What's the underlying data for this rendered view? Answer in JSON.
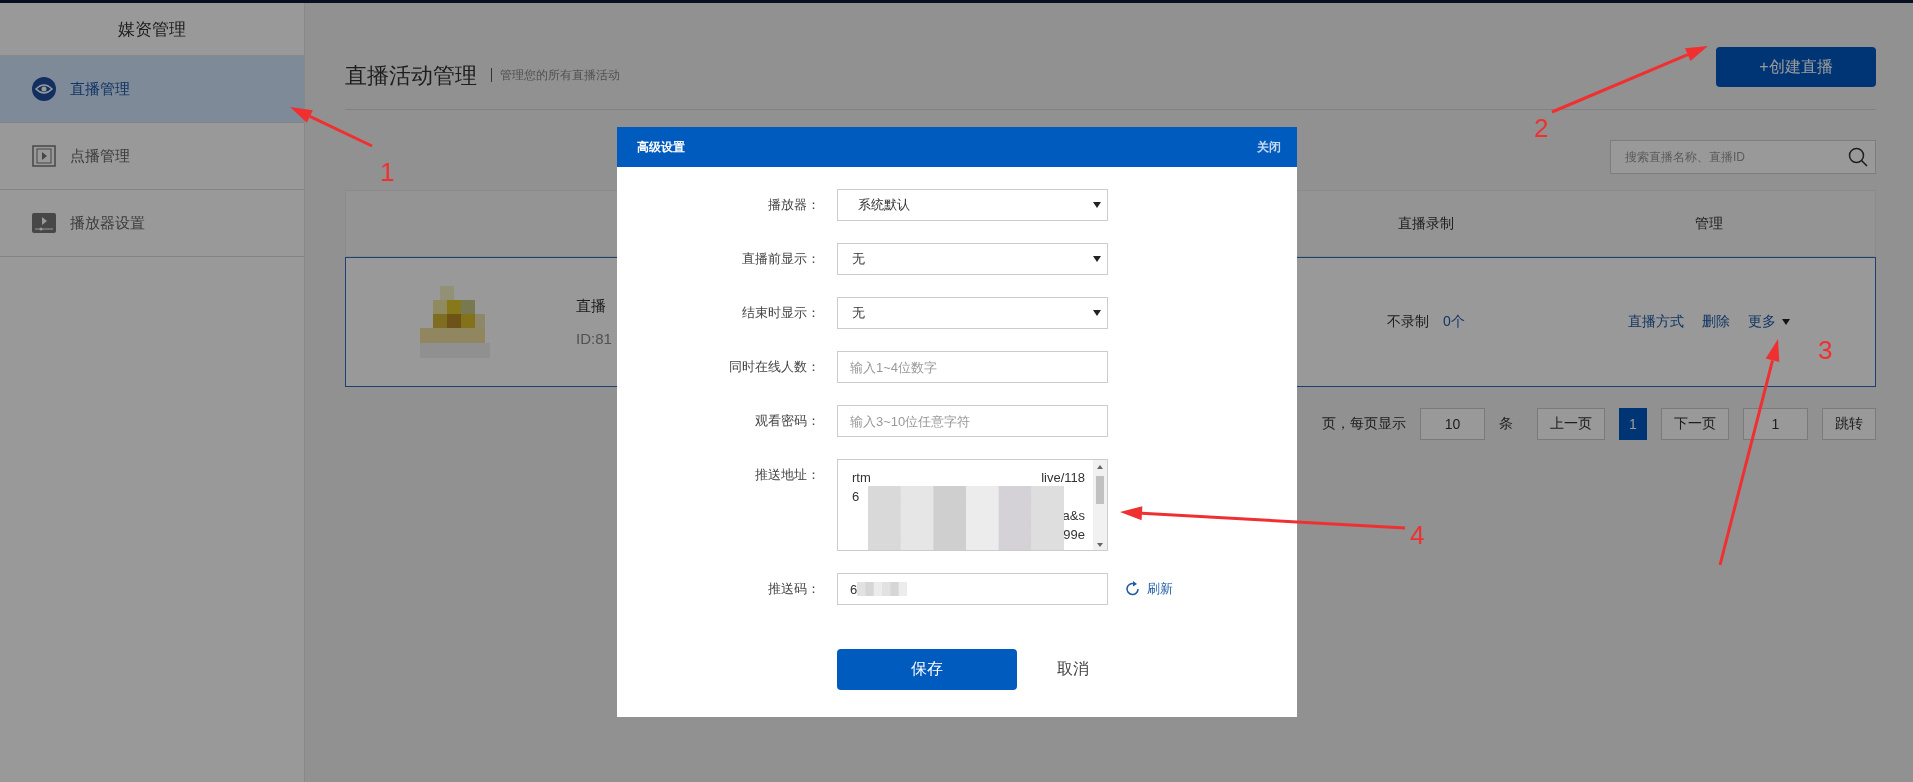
{
  "sidebar": {
    "title": "媒资管理",
    "items": [
      {
        "label": "直播管理",
        "selected": true
      },
      {
        "label": "点播管理",
        "selected": false
      },
      {
        "label": "播放器设置",
        "selected": false
      }
    ]
  },
  "page": {
    "title": "直播活动管理",
    "subtitle": "管理您的所有直播活动",
    "create_button": "+创建直播",
    "search": {
      "placeholder": "搜索直播名称、直播ID"
    }
  },
  "table": {
    "columns": [
      "直播录制",
      "管理"
    ],
    "rows": [
      {
        "thumbnail": {
          "kind": "picture"
        },
        "name": "直播",
        "id": "ID:81",
        "record": "不录制",
        "record_count": "0个",
        "actions": [
          "直播方式",
          "删除",
          "更多"
        ]
      }
    ]
  },
  "pagination": {
    "info": "页，每页显示",
    "page_size": "10",
    "unit": "条",
    "prev": "上一页",
    "pages": [
      {
        "label": "1",
        "selected": true
      }
    ],
    "next": "下一页",
    "jump_value": "1",
    "jump": "跳转"
  },
  "dialog": {
    "title": "高级设置",
    "close": "关闭",
    "fields": [
      {
        "kind": "select",
        "label": "播放器：",
        "value": "系统默认"
      },
      {
        "kind": "select",
        "label": "直播前显示：",
        "value": "无"
      },
      {
        "kind": "select",
        "label": "结束时显示：",
        "value": "无"
      },
      {
        "kind": "input",
        "label": "同时在线人数：",
        "placeholder": "输入1~4位数字"
      },
      {
        "kind": "input",
        "label": "观看密码：",
        "placeholder": "输入3~10位任意字符"
      },
      {
        "kind": "textarea",
        "label": "推送地址：",
        "lines": [
          {
            "start": "rtm",
            "end": "live/118"
          },
          {
            "start": "6"
          },
          {
            "end": "a&s"
          },
          {
            "end": "99e"
          }
        ]
      },
      {
        "kind": "code",
        "label": "推送码：",
        "value": "6",
        "action": "刷新"
      }
    ],
    "save": "保存",
    "cancel": "取消"
  },
  "annotations": [
    {
      "label": "1"
    },
    {
      "label": "2"
    },
    {
      "label": "3"
    },
    {
      "label": "4"
    }
  ]
}
